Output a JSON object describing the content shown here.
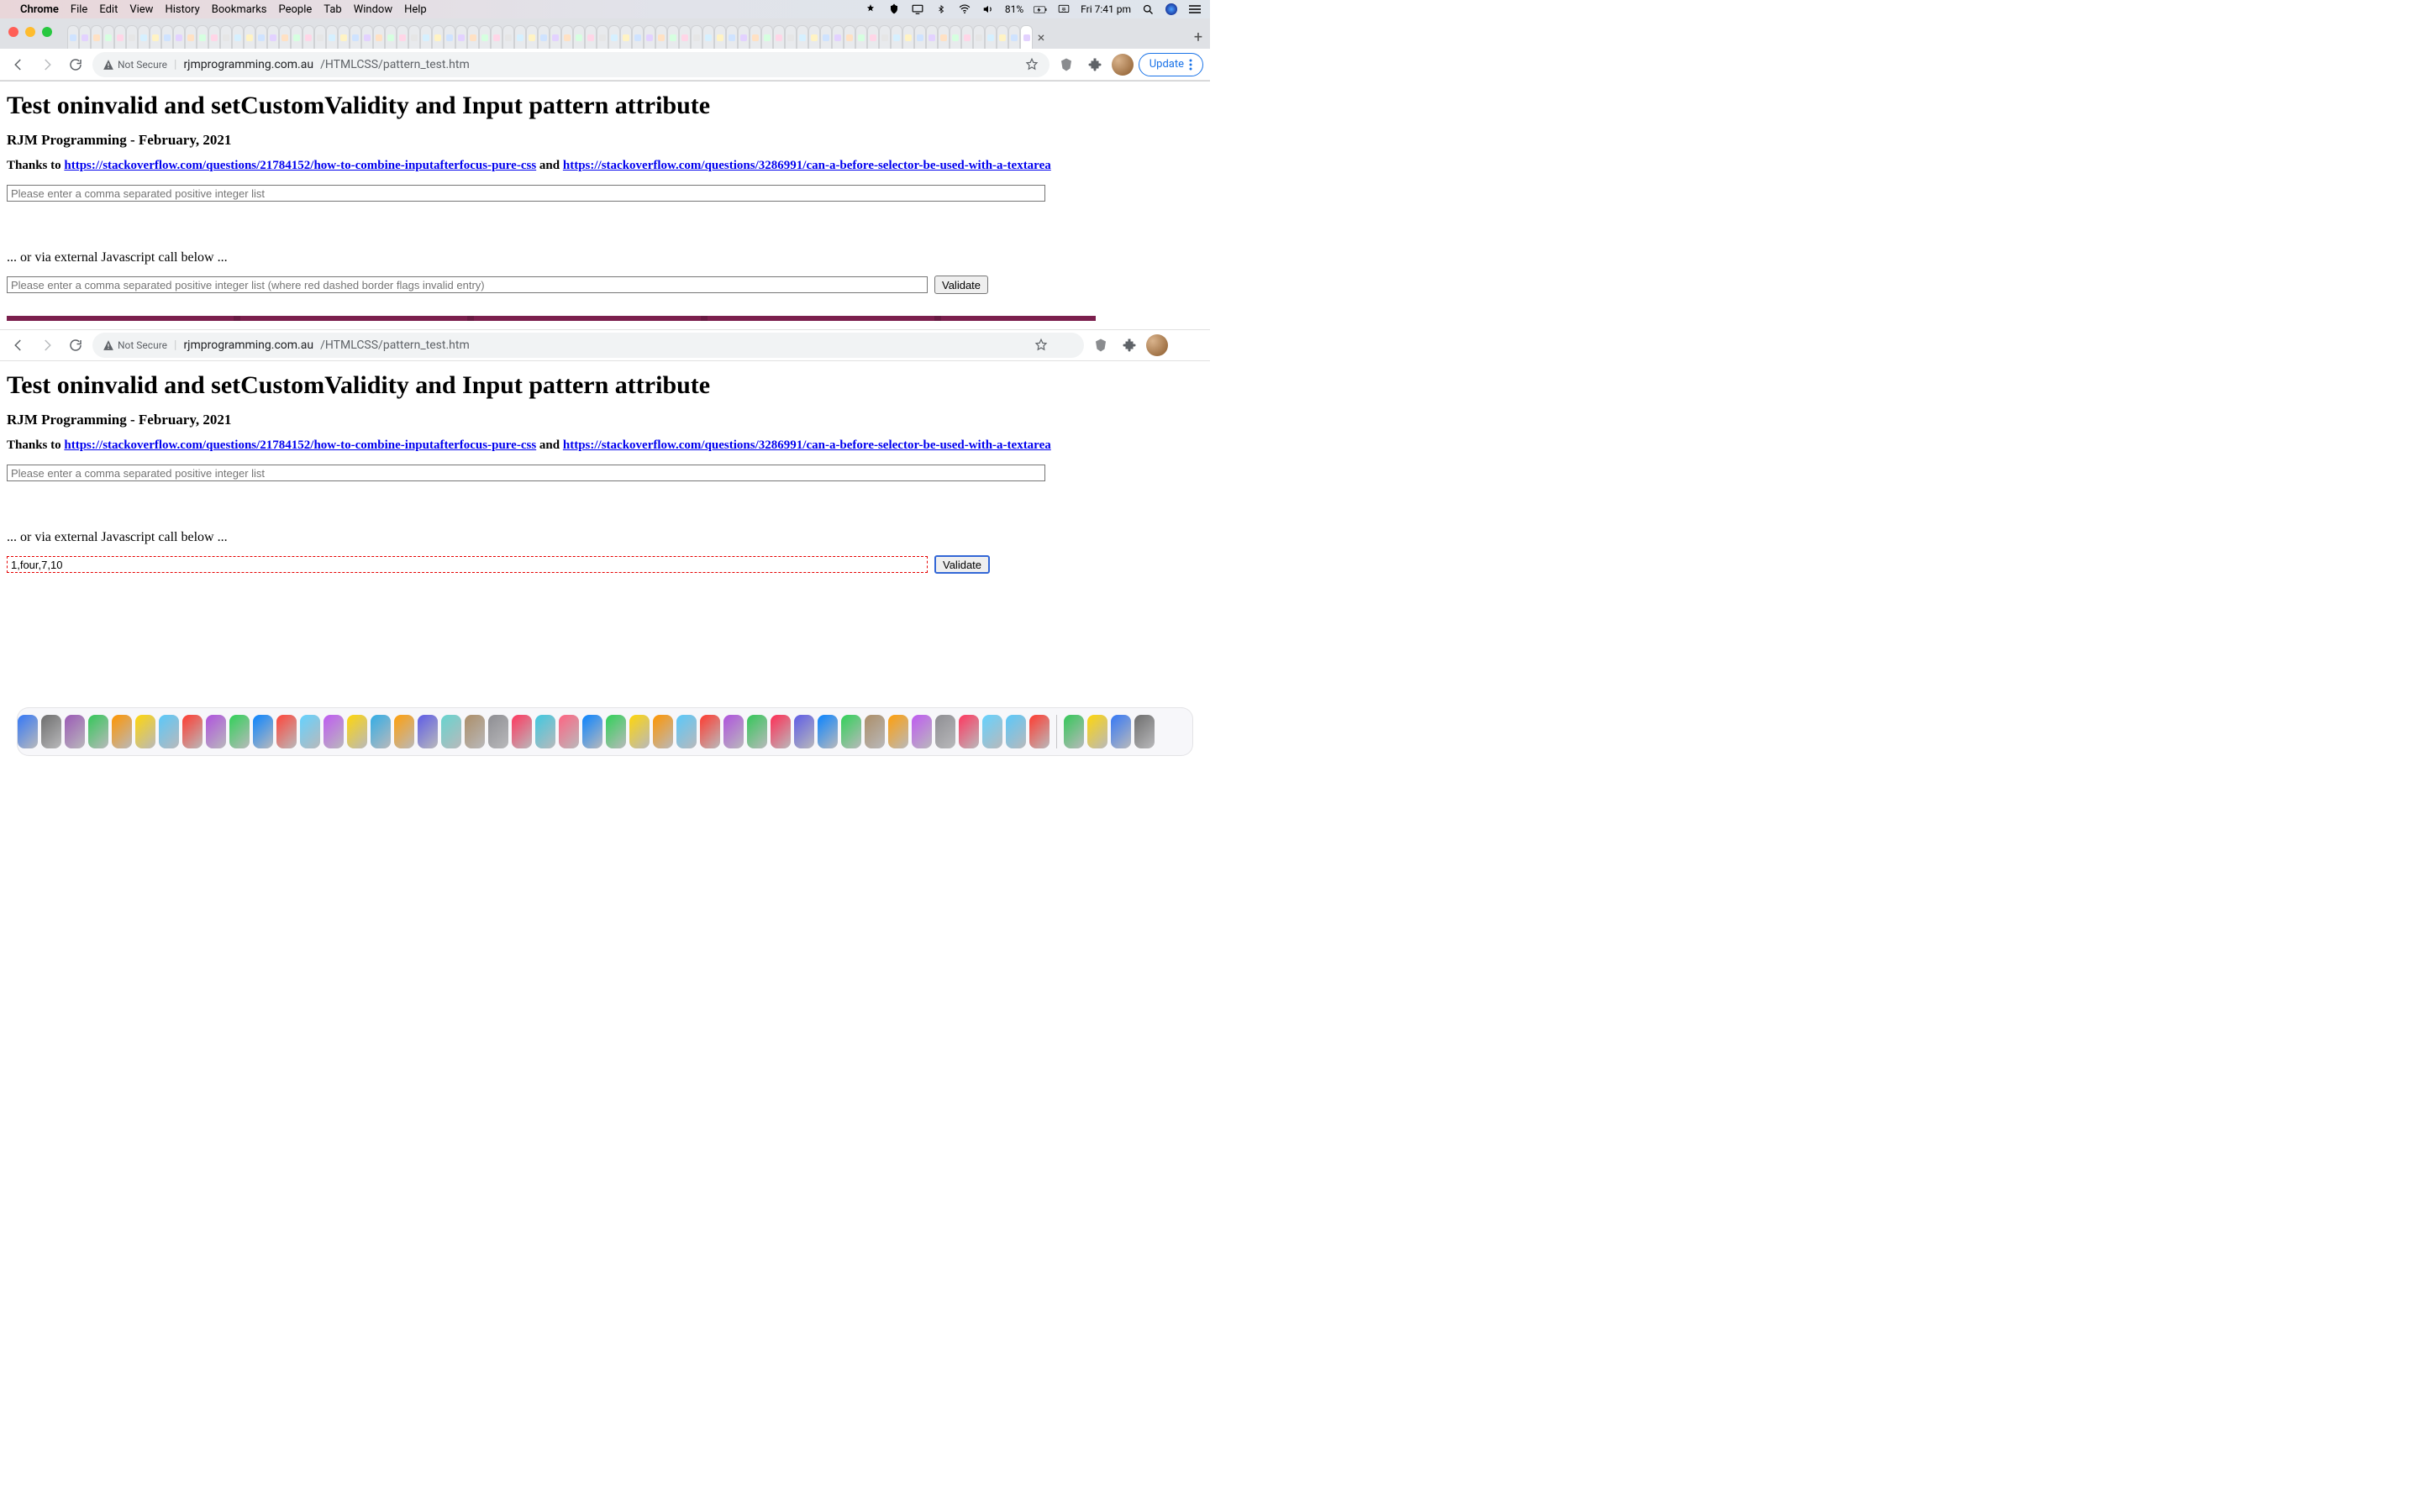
{
  "menubar": {
    "app": "Chrome",
    "items": [
      "File",
      "Edit",
      "View",
      "History",
      "Bookmarks",
      "People",
      "Tab",
      "Window",
      "Help"
    ],
    "battery": "81%",
    "clock": "Fri 7:41 pm"
  },
  "toolbar": {
    "not_secure": "Not Secure",
    "url_host": "rjmprogramming.com.au",
    "url_path": "/HTMLCSS/pattern_test.htm",
    "update_label": "Update"
  },
  "page": {
    "title": "Test oninvalid and setCustomValidity and Input pattern attribute",
    "subtitle": "RJM Programming - February, 2021",
    "thanks_prefix": "Thanks to ",
    "thanks_and": " and ",
    "link1": "https://stackoverflow.com/questions/21784152/how-to-combine-inputafterfocus-pure-css",
    "link2": "https://stackoverflow.com/questions/3286991/can-a-before-selector-be-used-with-a-textarea",
    "input1_placeholder": "Please enter a comma separated positive integer list",
    "sep_text": "... or via external Javascript call below ...",
    "input2_placeholder": "Please enter a comma separated positive integer list (where red dashed border flags invalid entry)",
    "validate_label": "Validate",
    "input2_invalid_value": "1,four,7,10"
  }
}
